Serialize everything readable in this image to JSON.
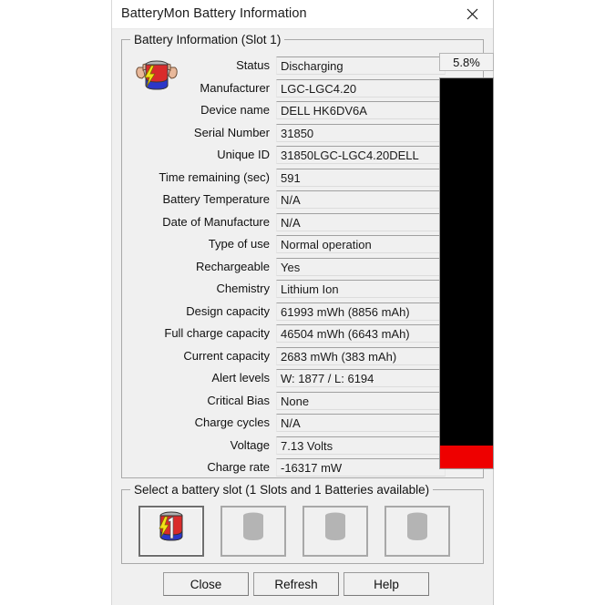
{
  "window": {
    "title": "BatteryMon Battery Information",
    "close_icon": "close-icon"
  },
  "info_group": {
    "title": "Battery Information (Slot 1)",
    "icon": "battery-strong-icon",
    "fields": [
      {
        "label": "Status",
        "value": "Discharging"
      },
      {
        "label": "Manufacturer",
        "value": "LGC-LGC4.20"
      },
      {
        "label": "Device name",
        "value": "DELL HK6DV6A"
      },
      {
        "label": "Serial Number",
        "value": "31850"
      },
      {
        "label": "Unique ID",
        "value": "31850LGC-LGC4.20DELL"
      },
      {
        "label": "Time remaining (sec)",
        "value": "591"
      },
      {
        "label": "Battery Temperature",
        "value": "N/A"
      },
      {
        "label": "Date of Manufacture",
        "value": "N/A"
      },
      {
        "label": "Type of use",
        "value": "Normal operation"
      },
      {
        "label": "Rechargeable",
        "value": "Yes"
      },
      {
        "label": "Chemistry",
        "value": "Lithium Ion"
      },
      {
        "label": "Design capacity",
        "value": "61993 mWh (8856 mAh)"
      },
      {
        "label": "Full charge capacity",
        "value": "46504 mWh (6643 mAh)"
      },
      {
        "label": "Current capacity",
        "value": "2683 mWh (383 mAh)"
      },
      {
        "label": "Alert levels",
        "value": "W: 1877 / L: 6194"
      },
      {
        "label": "Critical Bias",
        "value": "None"
      },
      {
        "label": "Charge cycles",
        "value": "N/A"
      },
      {
        "label": "Voltage",
        "value": "7.13 Volts"
      },
      {
        "label": "Charge rate",
        "value": "-16317 mW"
      }
    ]
  },
  "gauge": {
    "percent_label": "5.8%",
    "percent_value": 5.8,
    "fill_color": "#ee0000",
    "empty_color": "#000000"
  },
  "slots_group": {
    "title": "Select a battery slot (1 Slots and 1 Batteries available)",
    "slots": [
      {
        "index": 1,
        "icon": "battery-slot-1-icon",
        "occupied": true,
        "selected": true
      },
      {
        "index": 2,
        "icon": "battery-slot-empty-icon",
        "occupied": false,
        "selected": false
      },
      {
        "index": 3,
        "icon": "battery-slot-empty-icon",
        "occupied": false,
        "selected": false
      },
      {
        "index": 4,
        "icon": "battery-slot-empty-icon",
        "occupied": false,
        "selected": false
      }
    ]
  },
  "buttons": {
    "close": "Close",
    "refresh": "Refresh",
    "help": "Help"
  }
}
